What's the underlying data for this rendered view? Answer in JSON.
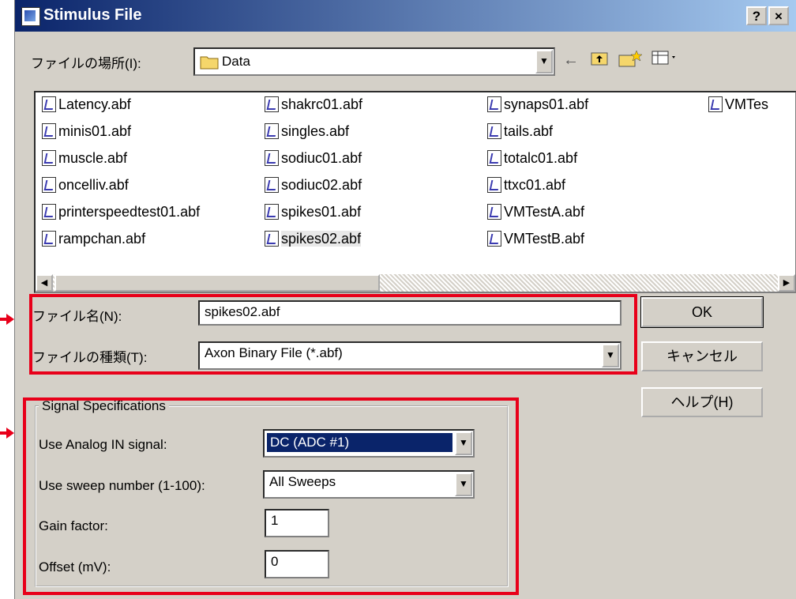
{
  "window": {
    "title": "Stimulus File",
    "help_btn": "?",
    "close_btn": "×"
  },
  "location": {
    "label": "ファイルの場所(I):",
    "value": "Data"
  },
  "files": [
    "Latency.abf",
    "minis01.abf",
    "muscle.abf",
    "oncelliv.abf",
    "printerspeedtest01.abf",
    "rampchan.abf",
    "shakrc01.abf",
    "singles.abf",
    "sodiuc01.abf",
    "sodiuc02.abf",
    "spikes01.abf",
    "spikes02.abf",
    "synaps01.abf",
    "tails.abf",
    "totalc01.abf",
    "ttxc01.abf",
    "VMTestA.abf",
    "VMTestB.abf",
    "VMTes"
  ],
  "filename": {
    "label": "ファイル名(N):",
    "value": "spikes02.abf"
  },
  "filetype": {
    "label": "ファイルの種類(T):",
    "value": "Axon Binary File (*.abf)"
  },
  "buttons": {
    "ok": "OK",
    "cancel": "キャンセル",
    "help": "ヘルプ(H)"
  },
  "signal": {
    "group_title": "Signal Specifications",
    "analog_label": "Use Analog IN signal:",
    "analog_value": "DC (ADC #1)",
    "sweep_label": "Use sweep number (1-100):",
    "sweep_value": "All Sweeps",
    "gain_label": "Gain factor:",
    "gain_value": "1",
    "offset_label": "Offset (mV):",
    "offset_value": "0"
  },
  "icons": {
    "back": "←",
    "up": "⌂",
    "newfolder": "✶",
    "view": "☷",
    "dropdown": "▼",
    "scroll_left": "◀",
    "scroll_right": "▶"
  },
  "colors": {
    "highlight": "#e8001a",
    "selection": "#0a246a",
    "titlebar": "#0a246a"
  }
}
